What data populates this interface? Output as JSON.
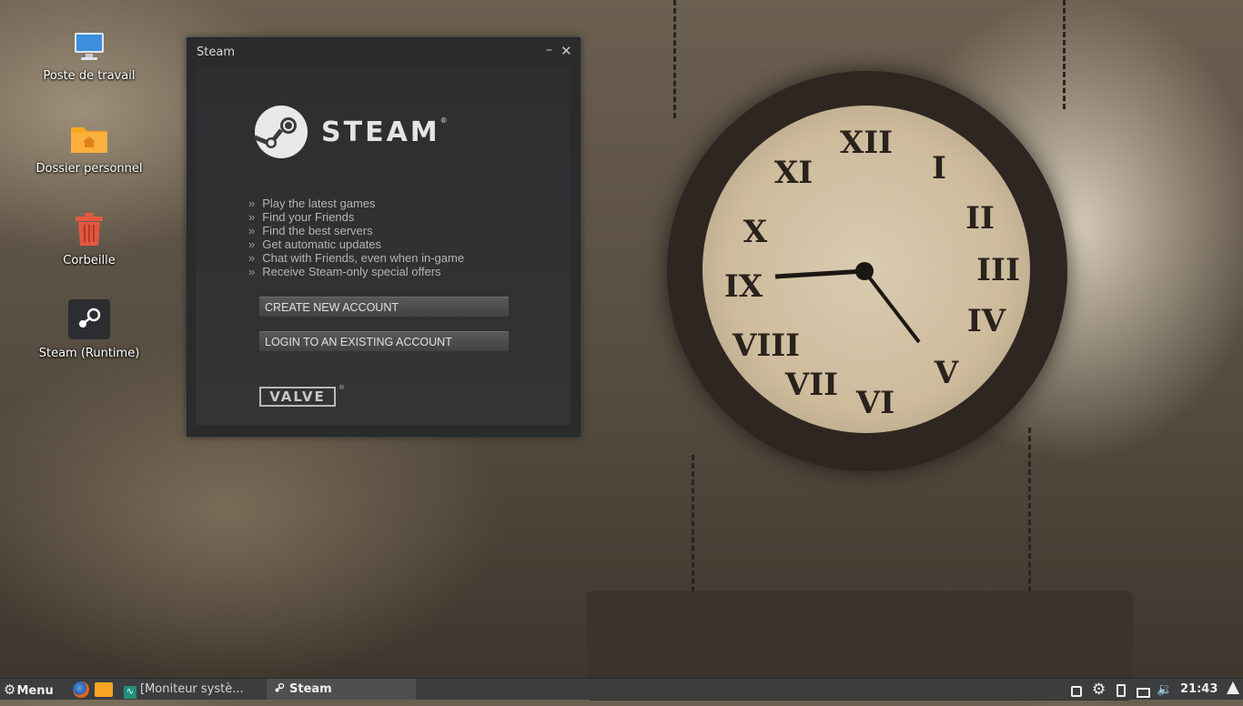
{
  "desktop": {
    "icons": [
      {
        "label": "Poste de travail",
        "icon": "computer-icon"
      },
      {
        "label": "Dossier personnel",
        "icon": "home-folder-icon"
      },
      {
        "label": "Corbeille",
        "icon": "trash-icon"
      },
      {
        "label": "Steam (Runtime)",
        "icon": "steam-icon"
      }
    ]
  },
  "steam_window": {
    "title": "Steam",
    "logo_text": "STEAM",
    "logo_reg": "®",
    "features": [
      "Play the latest games",
      "Find your Friends",
      "Find the best servers",
      "Get automatic updates",
      "Chat with Friends, even when in-game",
      "Receive Steam-only special offers"
    ],
    "bullet": "»",
    "create_button": "CREATE NEW ACCOUNT",
    "login_button": "LOGIN TO AN EXISTING ACCOUNT",
    "valve_logo": "VALVE",
    "valve_reg": "®"
  },
  "taskbar": {
    "menu_label": "Menu",
    "tasks": [
      {
        "label": "[Moniteur systè...",
        "icon": "system-monitor-icon"
      },
      {
        "label": "Steam",
        "icon": "steam-icon"
      }
    ],
    "clock": "21:43"
  },
  "colors": {
    "window_bg": "#2a2b2c",
    "taskbar_bg": "#3b3d3e",
    "folder_orange": "#f6a623",
    "trash_red": "#e3573f"
  }
}
